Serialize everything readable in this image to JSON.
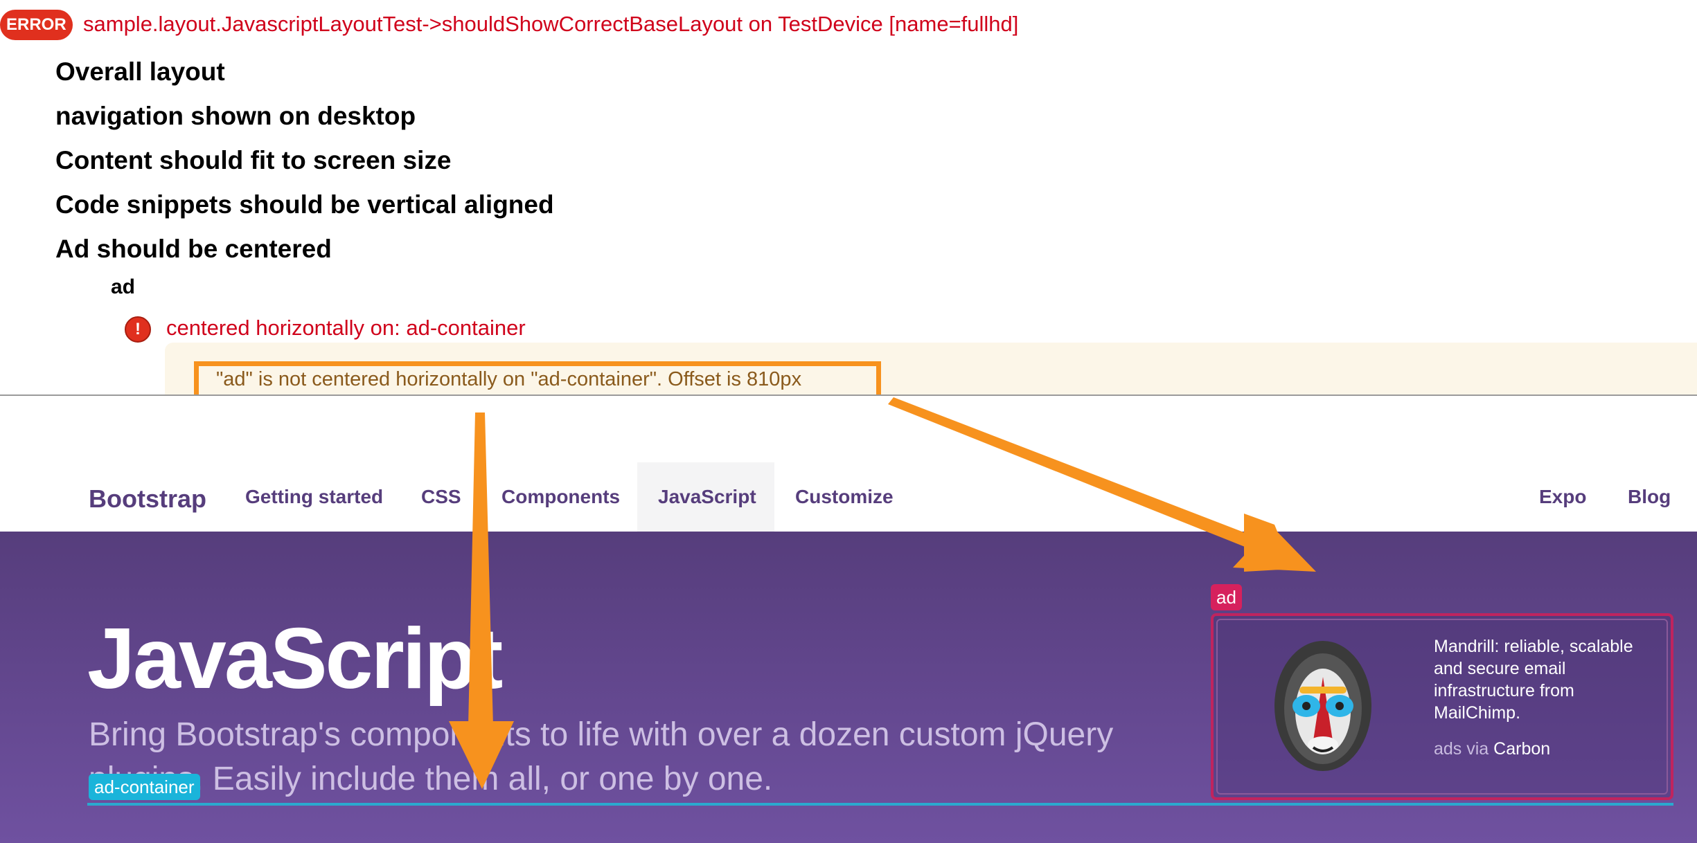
{
  "report": {
    "status_badge": "ERROR",
    "test_title": "sample.layout.JavascriptLayoutTest->shouldShowCorrectBaseLayout on TestDevice [name=fullhd]",
    "sections": [
      "Overall layout",
      "navigation shown on desktop",
      "Content should fit to screen size",
      "Code snippets should be vertical aligned",
      "Ad should be centered"
    ],
    "object_name": "ad",
    "spec_icon": "!",
    "spec_text": "centered horizontally on: ad-container",
    "error_message": "\"ad\" is not centered horizontally on \"ad-container\". Offset is 810px"
  },
  "site": {
    "brand": "Bootstrap",
    "nav_left": [
      "Getting started",
      "CSS",
      "Components",
      "JavaScript",
      "Customize"
    ],
    "nav_active": "JavaScript",
    "nav_right": [
      "Expo",
      "Blog"
    ],
    "hero_title": "JavaScript",
    "hero_lead": "Bring Bootstrap's components to life with over a dozen custom jQuery plugins. Easily include them all, or one by one.",
    "container_label": "ad-container",
    "ad_label": "ad",
    "ad_text": "Mandrill: reliable, scalable and secure email infrastructure from MailChimp.",
    "ad_via_prefix": "ads via",
    "ad_via_brand": "Carbon"
  },
  "colors": {
    "error_red": "#d0021b",
    "highlight_orange": "#f7921e",
    "bootstrap_purple": "#563d7c",
    "ad_pink": "#d6215d",
    "container_cyan": "#1ab4da"
  },
  "icons": [
    "error-icon",
    "arrow-icon",
    "mandrill-logo-icon"
  ]
}
